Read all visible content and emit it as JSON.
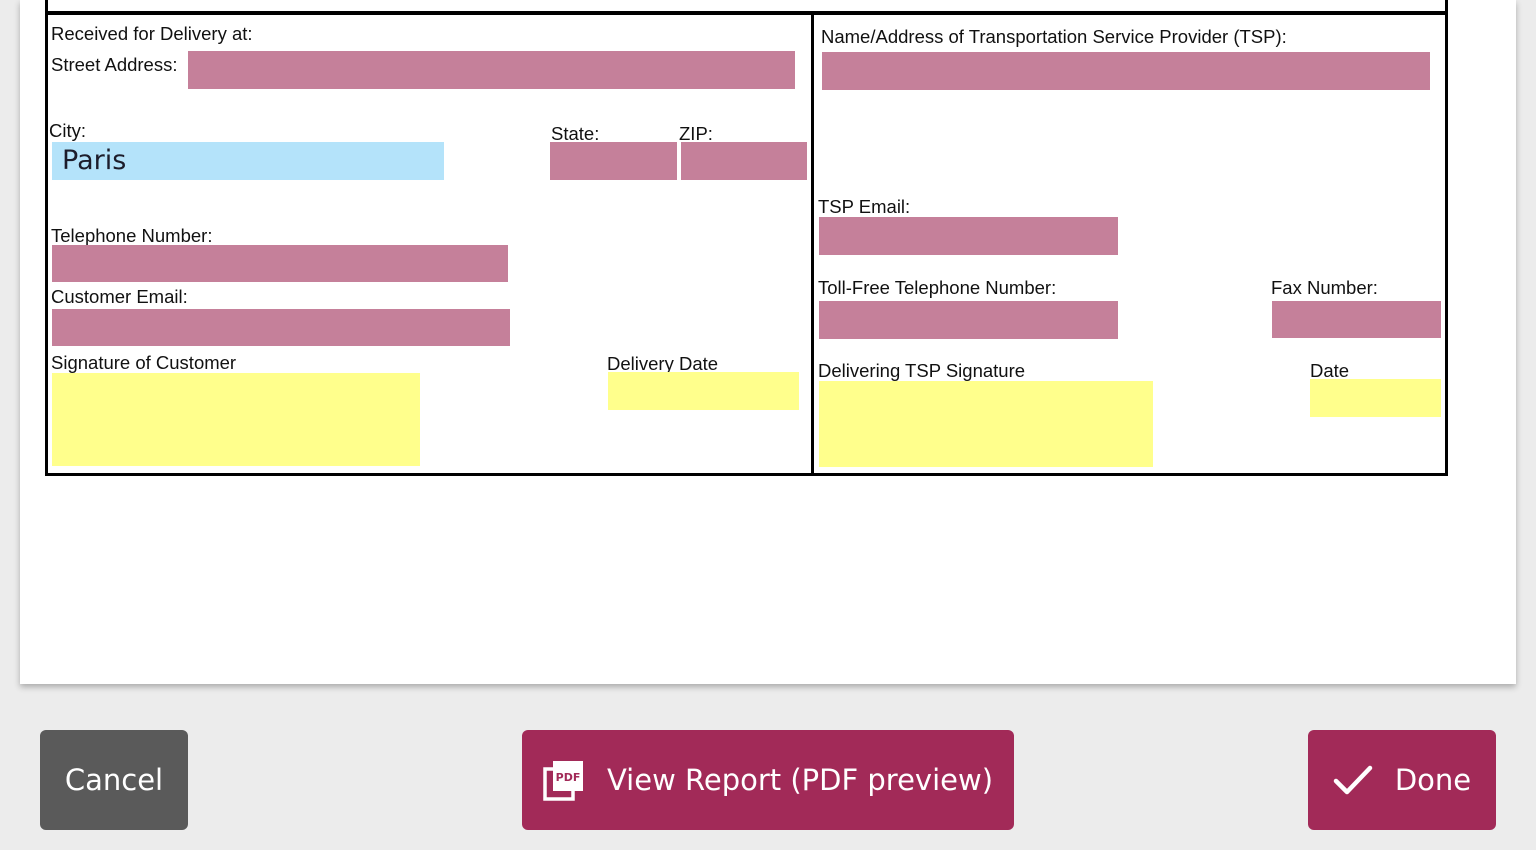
{
  "form": {
    "left": {
      "received_label": "Received for Delivery at:",
      "street_label": "Street Address:",
      "street_value": "",
      "city_label": "City:",
      "city_value": "Paris",
      "state_label": "State:",
      "state_value": "",
      "zip_label": "ZIP:",
      "zip_value": "",
      "telephone_label": "Telephone Number:",
      "telephone_value": "",
      "email_label": "Customer Email:",
      "email_value": "",
      "signature_label": "Signature of Customer",
      "delivery_date_label": "Delivery Date",
      "delivery_date_value": ""
    },
    "right": {
      "tsp_name_label": "Name/Address of Transportation Service Provider (TSP):",
      "tsp_name_value": "",
      "tsp_email_label": "TSP Email:",
      "tsp_email_value": "",
      "toll_free_label": "Toll-Free Telephone Number:",
      "toll_free_value": "",
      "fax_label": "Fax Number:",
      "fax_value": "",
      "tsp_signature_label": "Delivering TSP Signature",
      "date_label": "Date",
      "date_value": ""
    }
  },
  "field_colors": {
    "required": "#c5809a",
    "signature": "#ffff8c",
    "filled": "#b4e3fa"
  },
  "buttons": {
    "cancel_label": "Cancel",
    "view_report_label": "View Report (PDF preview)",
    "view_report_icon": "pdf-icon",
    "done_label": "Done",
    "done_icon": "checkmark-icon",
    "accent": "#a22a58",
    "cancel_color": "#5a5a5a"
  }
}
